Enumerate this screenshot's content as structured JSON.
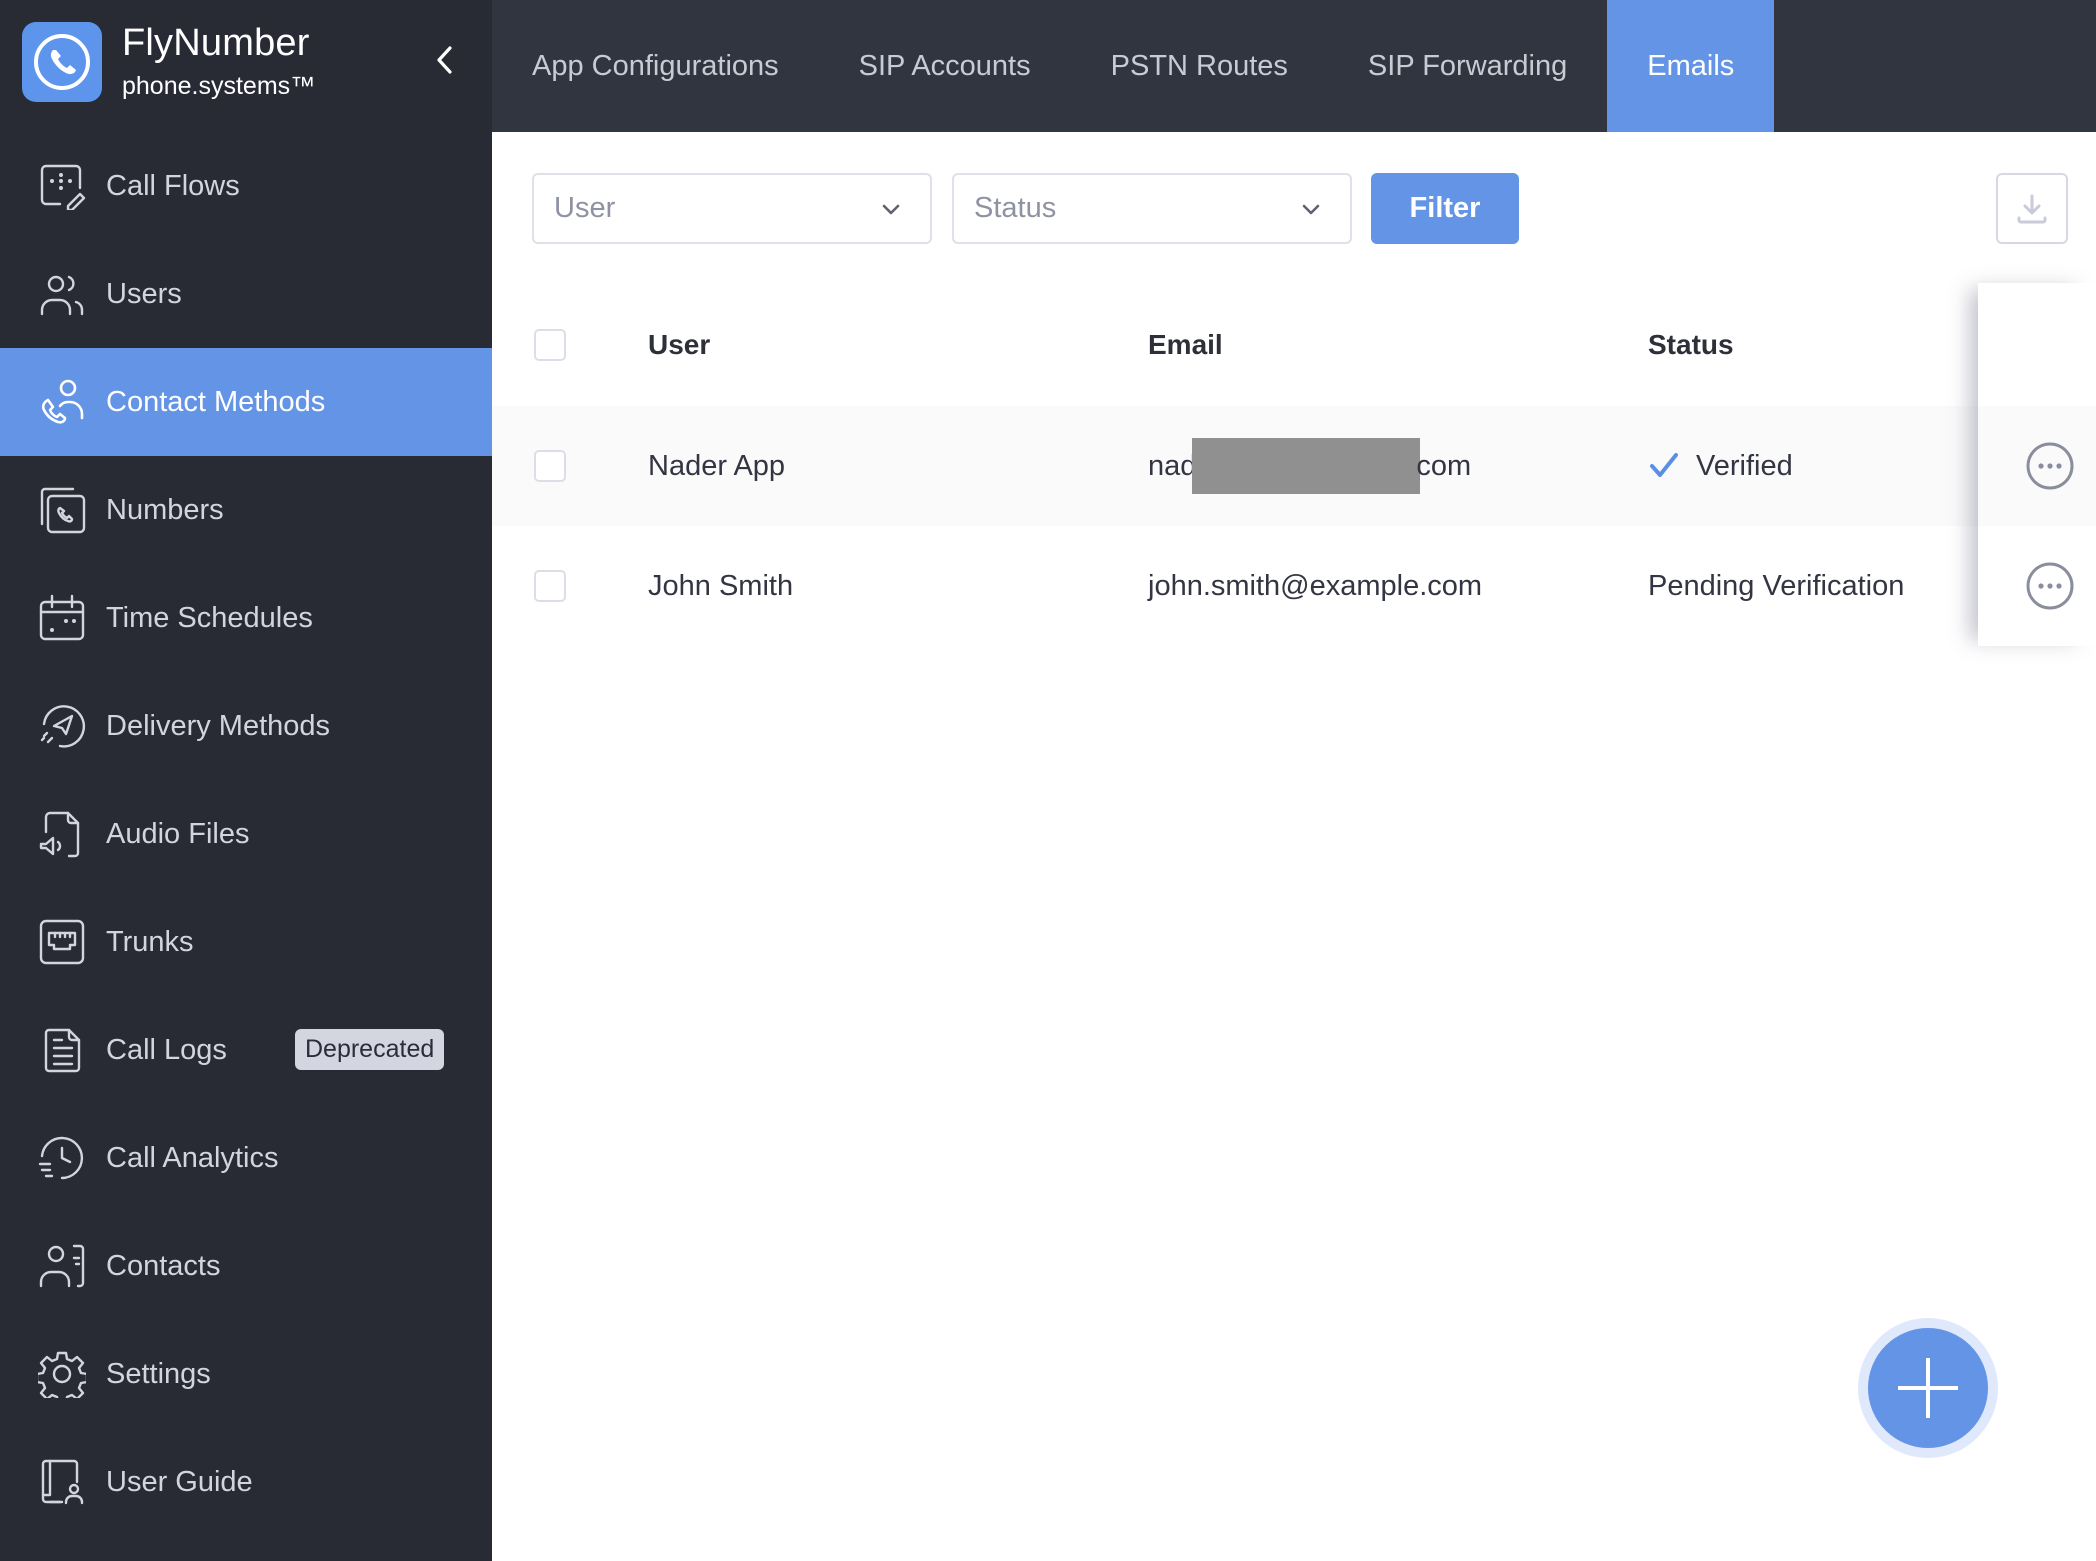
{
  "brand": {
    "title": "FlyNumber",
    "subtitle": "phone.systems™",
    "logo_icon": "phone-circle-icon",
    "collapse_icon": "chevron-left-icon"
  },
  "sidebar": {
    "items": [
      {
        "label": "Call Flows",
        "icon": "call-flows-icon",
        "active": false
      },
      {
        "label": "Users",
        "icon": "users-icon",
        "active": false
      },
      {
        "label": "Contact Methods",
        "icon": "contact-methods-icon",
        "active": true
      },
      {
        "label": "Numbers",
        "icon": "numbers-icon",
        "active": false
      },
      {
        "label": "Time Schedules",
        "icon": "calendar-icon",
        "active": false
      },
      {
        "label": "Delivery Methods",
        "icon": "paper-plane-icon",
        "active": false
      },
      {
        "label": "Audio Files",
        "icon": "audio-file-icon",
        "active": false
      },
      {
        "label": "Trunks",
        "icon": "trunk-icon",
        "active": false
      },
      {
        "label": "Call Logs",
        "icon": "document-icon",
        "active": false,
        "badge": "Deprecated"
      },
      {
        "label": "Call Analytics",
        "icon": "clock-history-icon",
        "active": false
      },
      {
        "label": "Contacts",
        "icon": "contact-card-icon",
        "active": false
      },
      {
        "label": "Settings",
        "icon": "gear-icon",
        "active": false
      },
      {
        "label": "User Guide",
        "icon": "user-guide-icon",
        "active": false
      }
    ]
  },
  "tabs": [
    {
      "label": "App Configurations",
      "active": false
    },
    {
      "label": "SIP Accounts",
      "active": false
    },
    {
      "label": "PSTN Routes",
      "active": false
    },
    {
      "label": "SIP Forwarding",
      "active": false
    },
    {
      "label": "Emails",
      "active": true
    }
  ],
  "filters": {
    "user_placeholder": "User",
    "status_placeholder": "Status",
    "filter_label": "Filter",
    "download_icon": "download-icon"
  },
  "table": {
    "columns": [
      "User",
      "Email",
      "Status"
    ],
    "rows": [
      {
        "user": "Nader App",
        "email_prefix": "nad",
        "email_suffix": "com",
        "email_redacted": true,
        "status": "Verified",
        "status_icon": "checkmark-icon"
      },
      {
        "user": "John Smith",
        "email": "john.smith@example.com",
        "status": "Pending Verification"
      }
    ]
  },
  "fab": {
    "icon": "plus-icon"
  },
  "colors": {
    "accent": "#6394e6",
    "sidebar_bg": "#292b34",
    "header_bg": "#31353f",
    "badge_bg": "#d3d5e0"
  }
}
